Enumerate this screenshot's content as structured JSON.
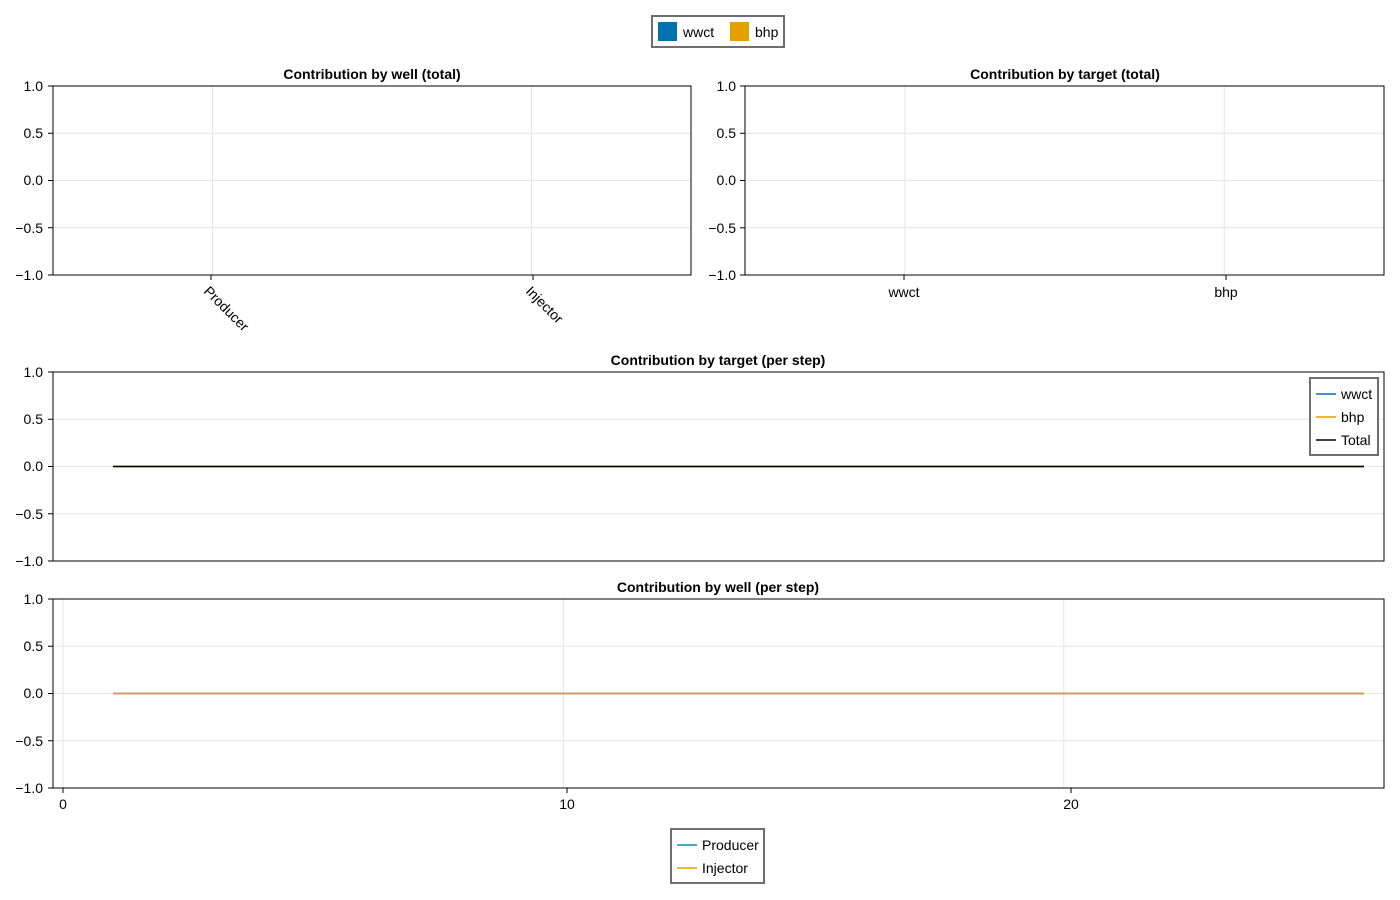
{
  "colors": {
    "wwct": "#0072b2",
    "bhp": "#e69f00",
    "total": "#000000",
    "producer": "#0f8cae",
    "injector": "#e69f00"
  },
  "top_legend": {
    "items": [
      {
        "label": "wwct",
        "color": "#0072b2"
      },
      {
        "label": "bhp",
        "color": "#e69f00"
      }
    ]
  },
  "bottom_legend": {
    "items": [
      {
        "label": "Producer",
        "color": "#0f8cae"
      },
      {
        "label": "Injector",
        "color": "#e69f00"
      }
    ]
  },
  "chart_data": [
    {
      "id": "well_total",
      "type": "bar",
      "title": "Contribution by well (total)",
      "categories": [
        "Producer",
        "Injector"
      ],
      "values": [],
      "ylim": [
        -1.0,
        1.0
      ],
      "yticks": [
        "1.0",
        "0.5",
        "0.0",
        "−0.5",
        "−1.0"
      ],
      "xtick_rotation": "rotated",
      "grid": true
    },
    {
      "id": "target_total",
      "type": "bar",
      "title": "Contribution by target (total)",
      "categories": [
        "wwct",
        "bhp"
      ],
      "values": [],
      "ylim": [
        -1.0,
        1.0
      ],
      "yticks": [
        "1.0",
        "0.5",
        "0.0",
        "−0.5",
        "−1.0"
      ],
      "grid": true
    },
    {
      "id": "target_step",
      "type": "line",
      "title": "Contribution by target (per step)",
      "xlim": [
        -0.2,
        26.4
      ],
      "ylim": [
        -1.0,
        1.0
      ],
      "yticks": [
        "1.0",
        "0.5",
        "0.0",
        "−0.5",
        "−1.0"
      ],
      "x": [
        1,
        26
      ],
      "series": [
        {
          "name": "wwct",
          "color": "#0072b2",
          "values": [
            0,
            0
          ]
        },
        {
          "name": "bhp",
          "color": "#e69f00",
          "values": [
            0,
            0
          ]
        },
        {
          "name": "Total",
          "color": "#000000",
          "values": [
            0,
            0
          ]
        }
      ],
      "legend": "top-right",
      "grid": true
    },
    {
      "id": "well_step",
      "type": "line",
      "title": "Contribution by well (per step)",
      "xlim": [
        -0.2,
        26.4
      ],
      "ylim": [
        -1.0,
        1.0
      ],
      "xticks": [
        "0",
        "10",
        "20"
      ],
      "yticks": [
        "1.0",
        "0.5",
        "0.0",
        "−0.5",
        "−1.0"
      ],
      "x": [
        1,
        26
      ],
      "series": [
        {
          "name": "Producer",
          "color": "#0f8cae",
          "values": [
            0,
            0
          ]
        },
        {
          "name": "Injector",
          "color": "#e69f00",
          "values": [
            0,
            0
          ]
        }
      ],
      "legend": "bottom",
      "grid": true
    }
  ]
}
